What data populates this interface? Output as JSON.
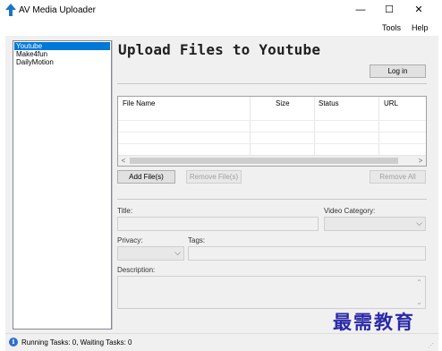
{
  "window": {
    "title": "AV Media Uploader",
    "minimize_glyph": "—",
    "maximize_glyph": "☐",
    "close_glyph": "✕",
    "app_icon": "upload-arrow-icon"
  },
  "menu": {
    "items": [
      {
        "label": "Tools"
      },
      {
        "label": "Help"
      }
    ]
  },
  "sidebar": {
    "items": [
      {
        "label": "Youtube",
        "selected": true
      },
      {
        "label": "Make4fun",
        "selected": false
      },
      {
        "label": "DailyMotion",
        "selected": false
      }
    ]
  },
  "main": {
    "title": "Upload Files to Youtube",
    "login_label": "Log in",
    "file_list": {
      "columns": [
        {
          "label": "File Name"
        },
        {
          "label": "Size"
        },
        {
          "label": "Status"
        },
        {
          "label": "URL"
        }
      ],
      "rows": [],
      "scroll_left_glyph": "<",
      "scroll_right_glyph": ">"
    },
    "buttons": {
      "add_files": "Add File(s)",
      "remove_files": "Remove File(s)",
      "remove_all": "Remove All"
    },
    "form": {
      "title_label": "Title:",
      "title_value": "",
      "video_category_label": "Video Category:",
      "video_category_value": "",
      "privacy_label": "Privacy:",
      "privacy_value": "",
      "tags_label": "Tags:",
      "tags_value": "",
      "description_label": "Description:",
      "description_value": "",
      "dropdown_glyph": "⌵"
    }
  },
  "status": {
    "icon": "info-icon",
    "icon_glyph": "i",
    "text": "Running Tasks: 0, Waiting Tasks: 0"
  },
  "overlay": {
    "watermark": "最需教育"
  },
  "colors": {
    "selection": "#0078d7",
    "window_bg": "#f0f0f0",
    "watermark": "#2a2aa8",
    "info_icon": "#2e6fc9"
  }
}
